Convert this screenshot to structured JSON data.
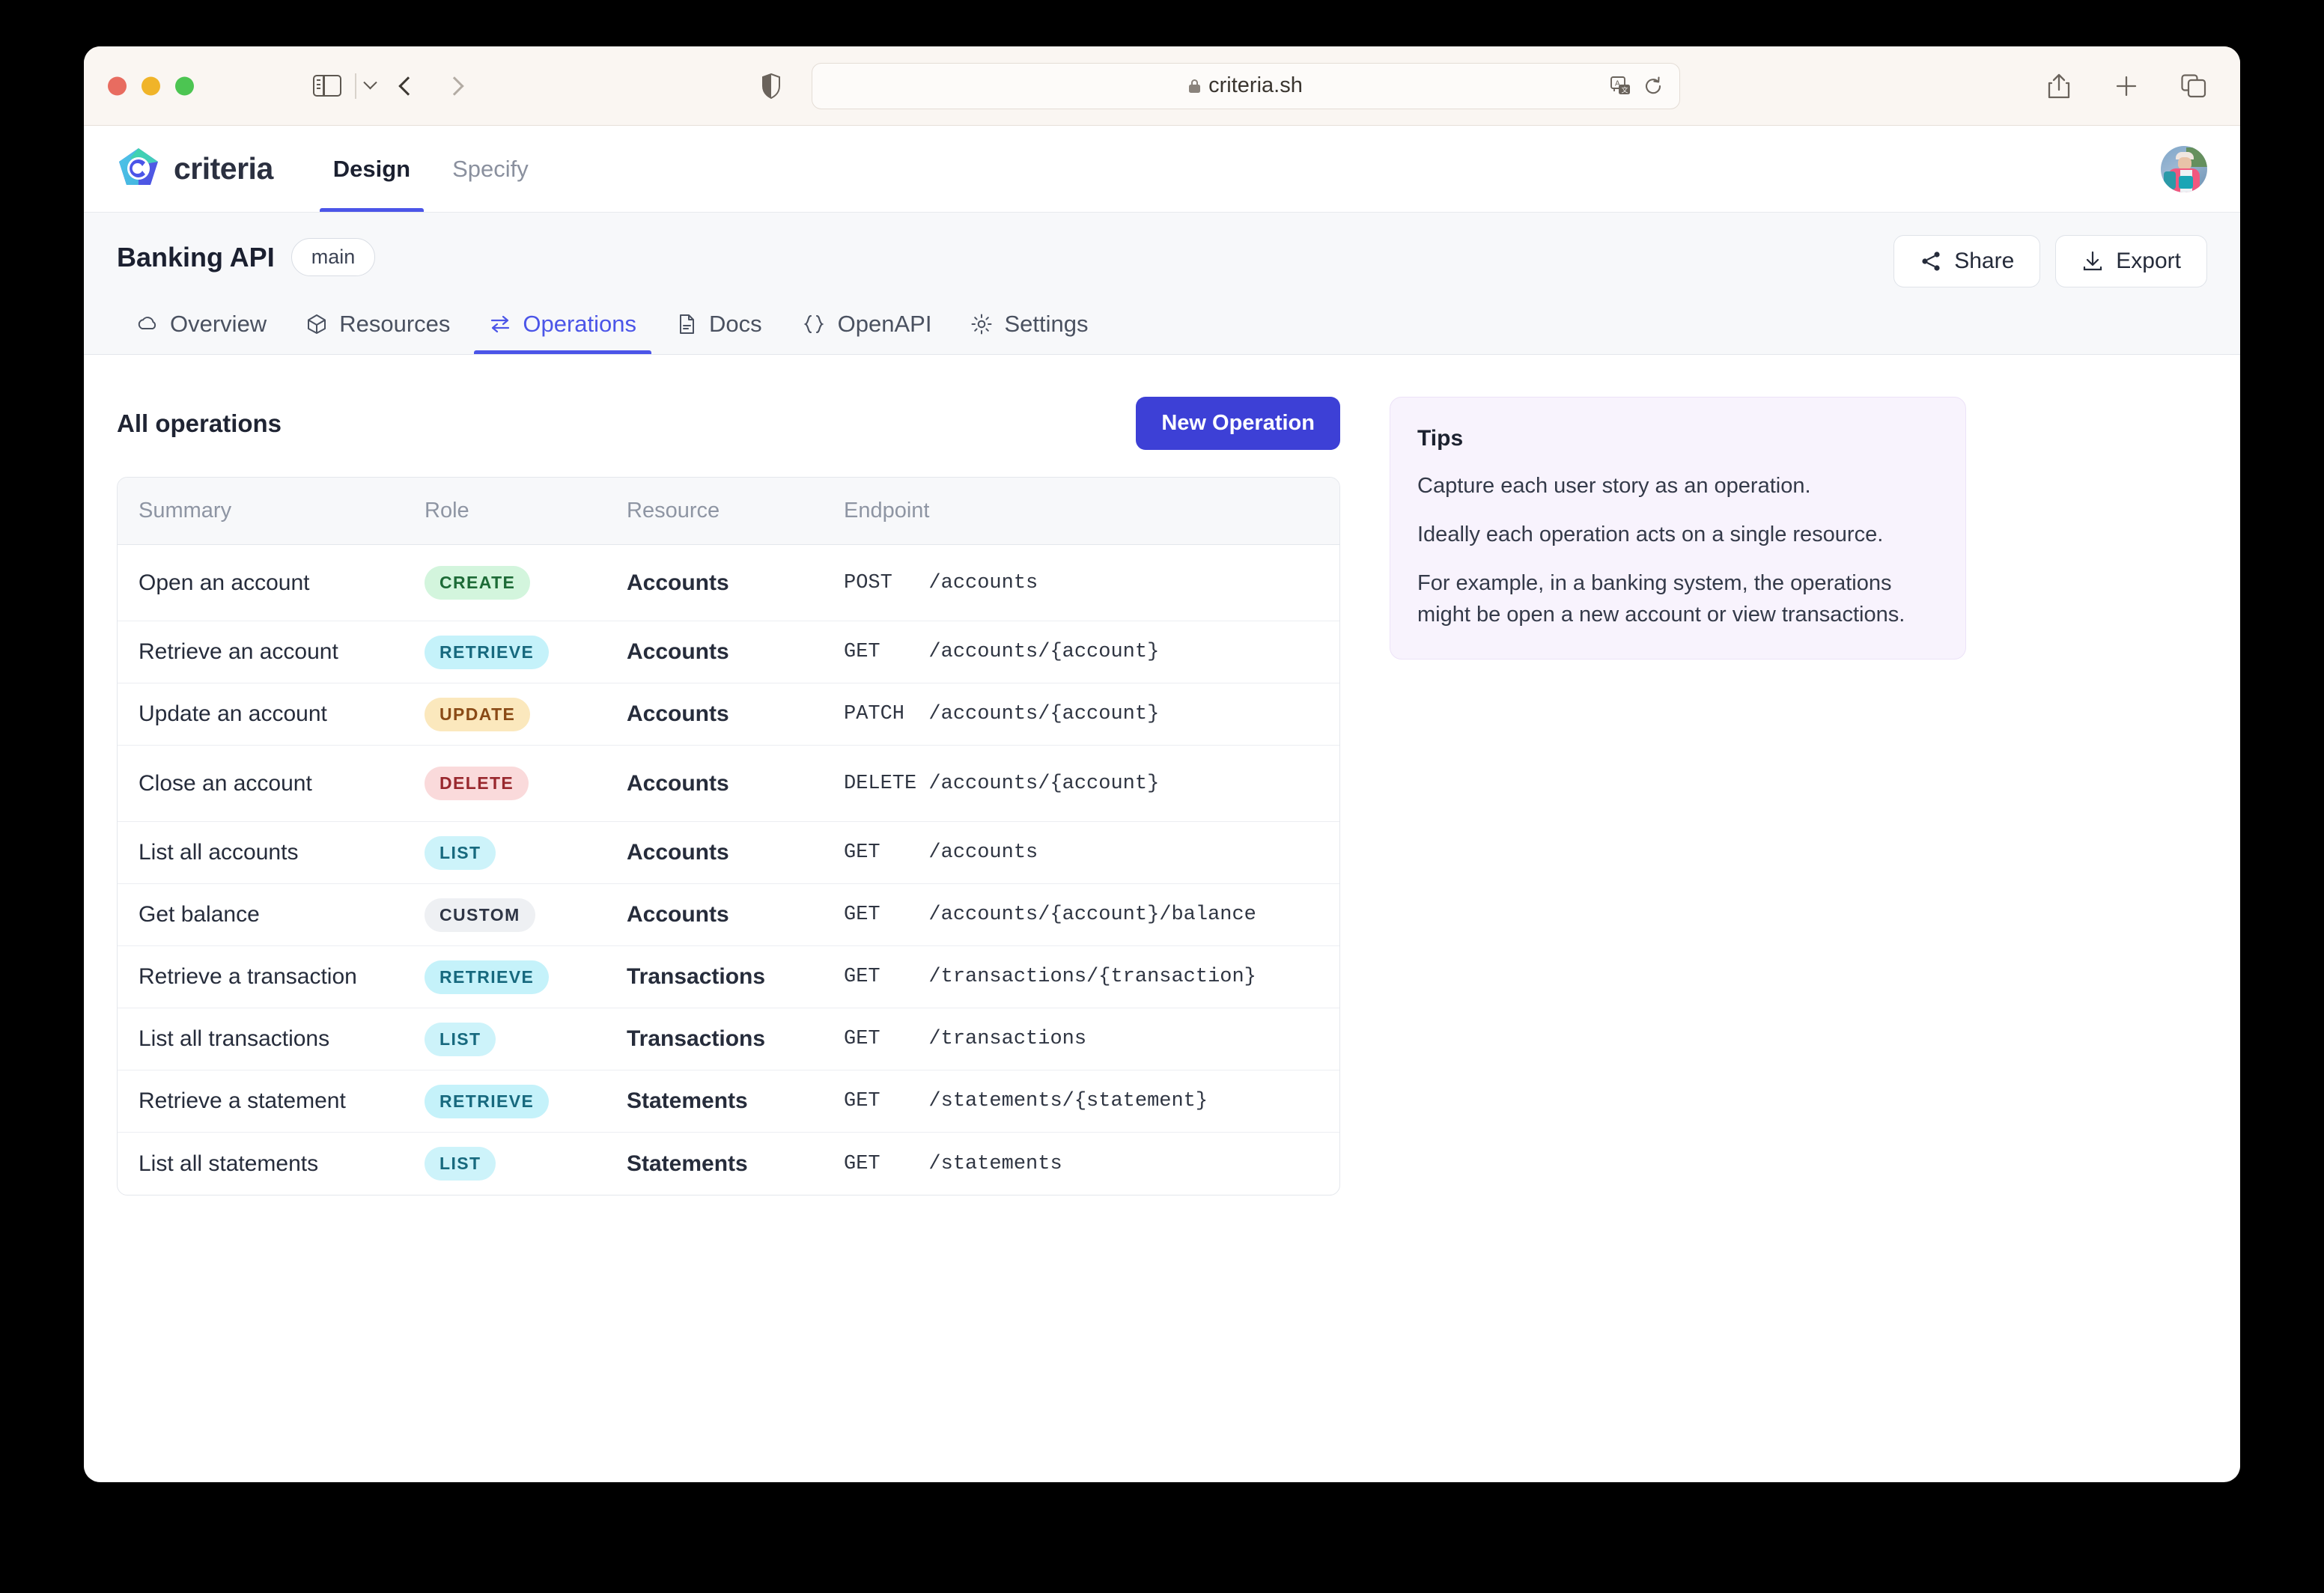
{
  "browser": {
    "url": "criteria.sh",
    "lock_icon": "lock-icon",
    "translate_icon": "translate-icon",
    "reload_icon": "reload-icon",
    "share_icon": "share-icon",
    "new_tab_icon": "plus-icon",
    "tab_overview_icon": "tab-overview-icon",
    "sidebar_icon": "sidebar-toggle-icon",
    "back_icon": "back-arrow-icon",
    "forward_icon": "forward-arrow-icon",
    "shield_icon": "privacy-shield-icon"
  },
  "app": {
    "brand_name": "criteria",
    "top_tabs": [
      {
        "label": "Design",
        "active": true
      },
      {
        "label": "Specify",
        "active": false
      }
    ],
    "avatar": "user-avatar"
  },
  "project": {
    "title": "Banking API",
    "branch": "main",
    "actions": [
      {
        "label": "Share",
        "icon": "share-nodes-icon"
      },
      {
        "label": "Export",
        "icon": "download-icon"
      }
    ]
  },
  "section_tabs": [
    {
      "label": "Overview",
      "icon": "cloud-icon",
      "active": false
    },
    {
      "label": "Resources",
      "icon": "cube-icon",
      "active": false
    },
    {
      "label": "Operations",
      "icon": "transfer-icon",
      "active": true
    },
    {
      "label": "Docs",
      "icon": "document-icon",
      "active": false
    },
    {
      "label": "OpenAPI",
      "icon": "braces-icon",
      "active": false
    },
    {
      "label": "Settings",
      "icon": "gear-icon",
      "active": false
    }
  ],
  "operations": {
    "heading": "All operations",
    "new_button": "New Operation",
    "columns": [
      "Summary",
      "Role",
      "Resource",
      "Endpoint"
    ],
    "rows": [
      {
        "summary": "Open an account",
        "role": "CREATE",
        "role_class": "create",
        "resource": "Accounts",
        "endpoint": "POST   /accounts",
        "tall": true
      },
      {
        "summary": "Retrieve an account",
        "role": "RETRIEVE",
        "role_class": "retrieve",
        "resource": "Accounts",
        "endpoint": "GET    /accounts/{account}",
        "tall": false
      },
      {
        "summary": "Update an account",
        "role": "UPDATE",
        "role_class": "update",
        "resource": "Accounts",
        "endpoint": "PATCH  /accounts/{account}",
        "tall": false
      },
      {
        "summary": "Close an account",
        "role": "DELETE",
        "role_class": "delete",
        "resource": "Accounts",
        "endpoint": "DELETE /accounts/{account}",
        "tall": true
      },
      {
        "summary": "List all accounts",
        "role": "LIST",
        "role_class": "list",
        "resource": "Accounts",
        "endpoint": "GET    /accounts",
        "tall": false
      },
      {
        "summary": "Get balance",
        "role": "CUSTOM",
        "role_class": "custom",
        "resource": "Accounts",
        "endpoint": "GET    /accounts/{account}/balance",
        "tall": false
      },
      {
        "summary": "Retrieve a transaction",
        "role": "RETRIEVE",
        "role_class": "retrieve",
        "resource": "Transactions",
        "endpoint": "GET    /transactions/{transaction}",
        "tall": false
      },
      {
        "summary": "List all transactions",
        "role": "LIST",
        "role_class": "list",
        "resource": "Transactions",
        "endpoint": "GET    /transactions",
        "tall": false
      },
      {
        "summary": "Retrieve a statement",
        "role": "RETRIEVE",
        "role_class": "retrieve",
        "resource": "Statements",
        "endpoint": "GET    /statements/{statement}",
        "tall": false
      },
      {
        "summary": "List all statements",
        "role": "LIST",
        "role_class": "list",
        "resource": "Statements",
        "endpoint": "GET    /statements",
        "tall": false
      }
    ]
  },
  "tips": {
    "title": "Tips",
    "paragraphs": [
      "Capture each user story as an operation.",
      "Ideally each operation acts on a single resource.",
      "For example, in a banking system, the operations might be open a new account or view transactions."
    ]
  },
  "colors": {
    "accent": "#4b55e8",
    "primary_button": "#3d40d6",
    "tips_bg": "#f8f3fd"
  }
}
